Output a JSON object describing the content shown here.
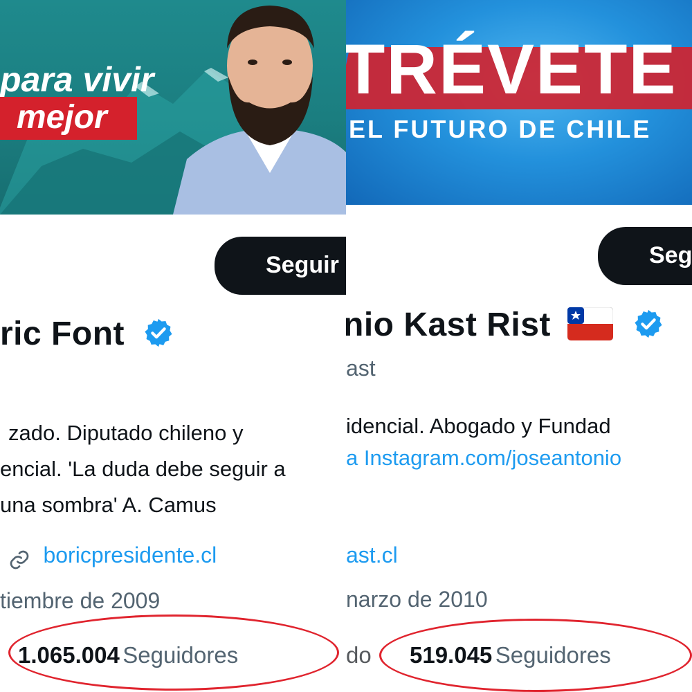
{
  "left_profile": {
    "banner": {
      "slogan_line1": "para vivir",
      "slogan_line2": "mejor",
      "colors": {
        "teal": "#1f8a8d",
        "red": "#d4212c"
      }
    },
    "follow_button": "Seguir",
    "display_name": "ric Font",
    "bio_lines": [
      "zado. Diputado chileno y",
      "encial. 'La duda debe seguir a",
      "una sombra' A. Camus"
    ],
    "link_text": "boricpresidente.cl",
    "joined_text": "tiembre de 2009",
    "followers_count": "1.065.004",
    "followers_label": "Seguidores"
  },
  "right_profile": {
    "banner": {
      "headline": "TRÉVETE",
      "subline": "EL FUTURO DE CHILE",
      "colors": {
        "blue": "#2391dc",
        "red": "#d4212c"
      }
    },
    "follow_button": "Seg",
    "display_name": "nio Kast Rist",
    "handle": "ast",
    "bio_lines": [
      "idencial. Abogado y Fundad"
    ],
    "bio_link": "Instagram.com/joseantonio",
    "link_text": "ast.cl",
    "joined_text": "narzo de 2010",
    "followers_prefix": "do",
    "followers_count": "519.045",
    "followers_label": "Seguidores"
  },
  "accent_colors": {
    "link": "#1d9bf0",
    "verified": "#1d9bf0",
    "highlight_oval": "#e0242e"
  }
}
